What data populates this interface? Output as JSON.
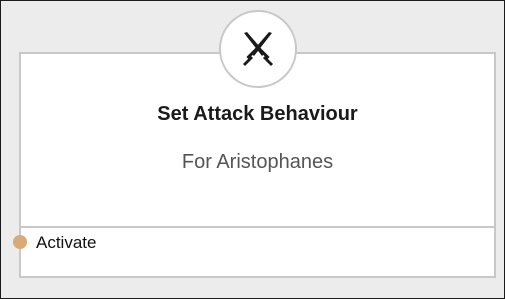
{
  "node": {
    "icon": "crossed-swords-icon",
    "title": "Set Attack Behaviour",
    "subtitle": "For Aristophanes",
    "input_port": {
      "label": "Activate",
      "color": "#d8aa7a"
    }
  },
  "colors": {
    "background": "#ececec",
    "node_border": "#c8c8c8",
    "node_fill": "#ffffff",
    "title_text": "#1a1a1a",
    "subtitle_text": "#555555"
  }
}
